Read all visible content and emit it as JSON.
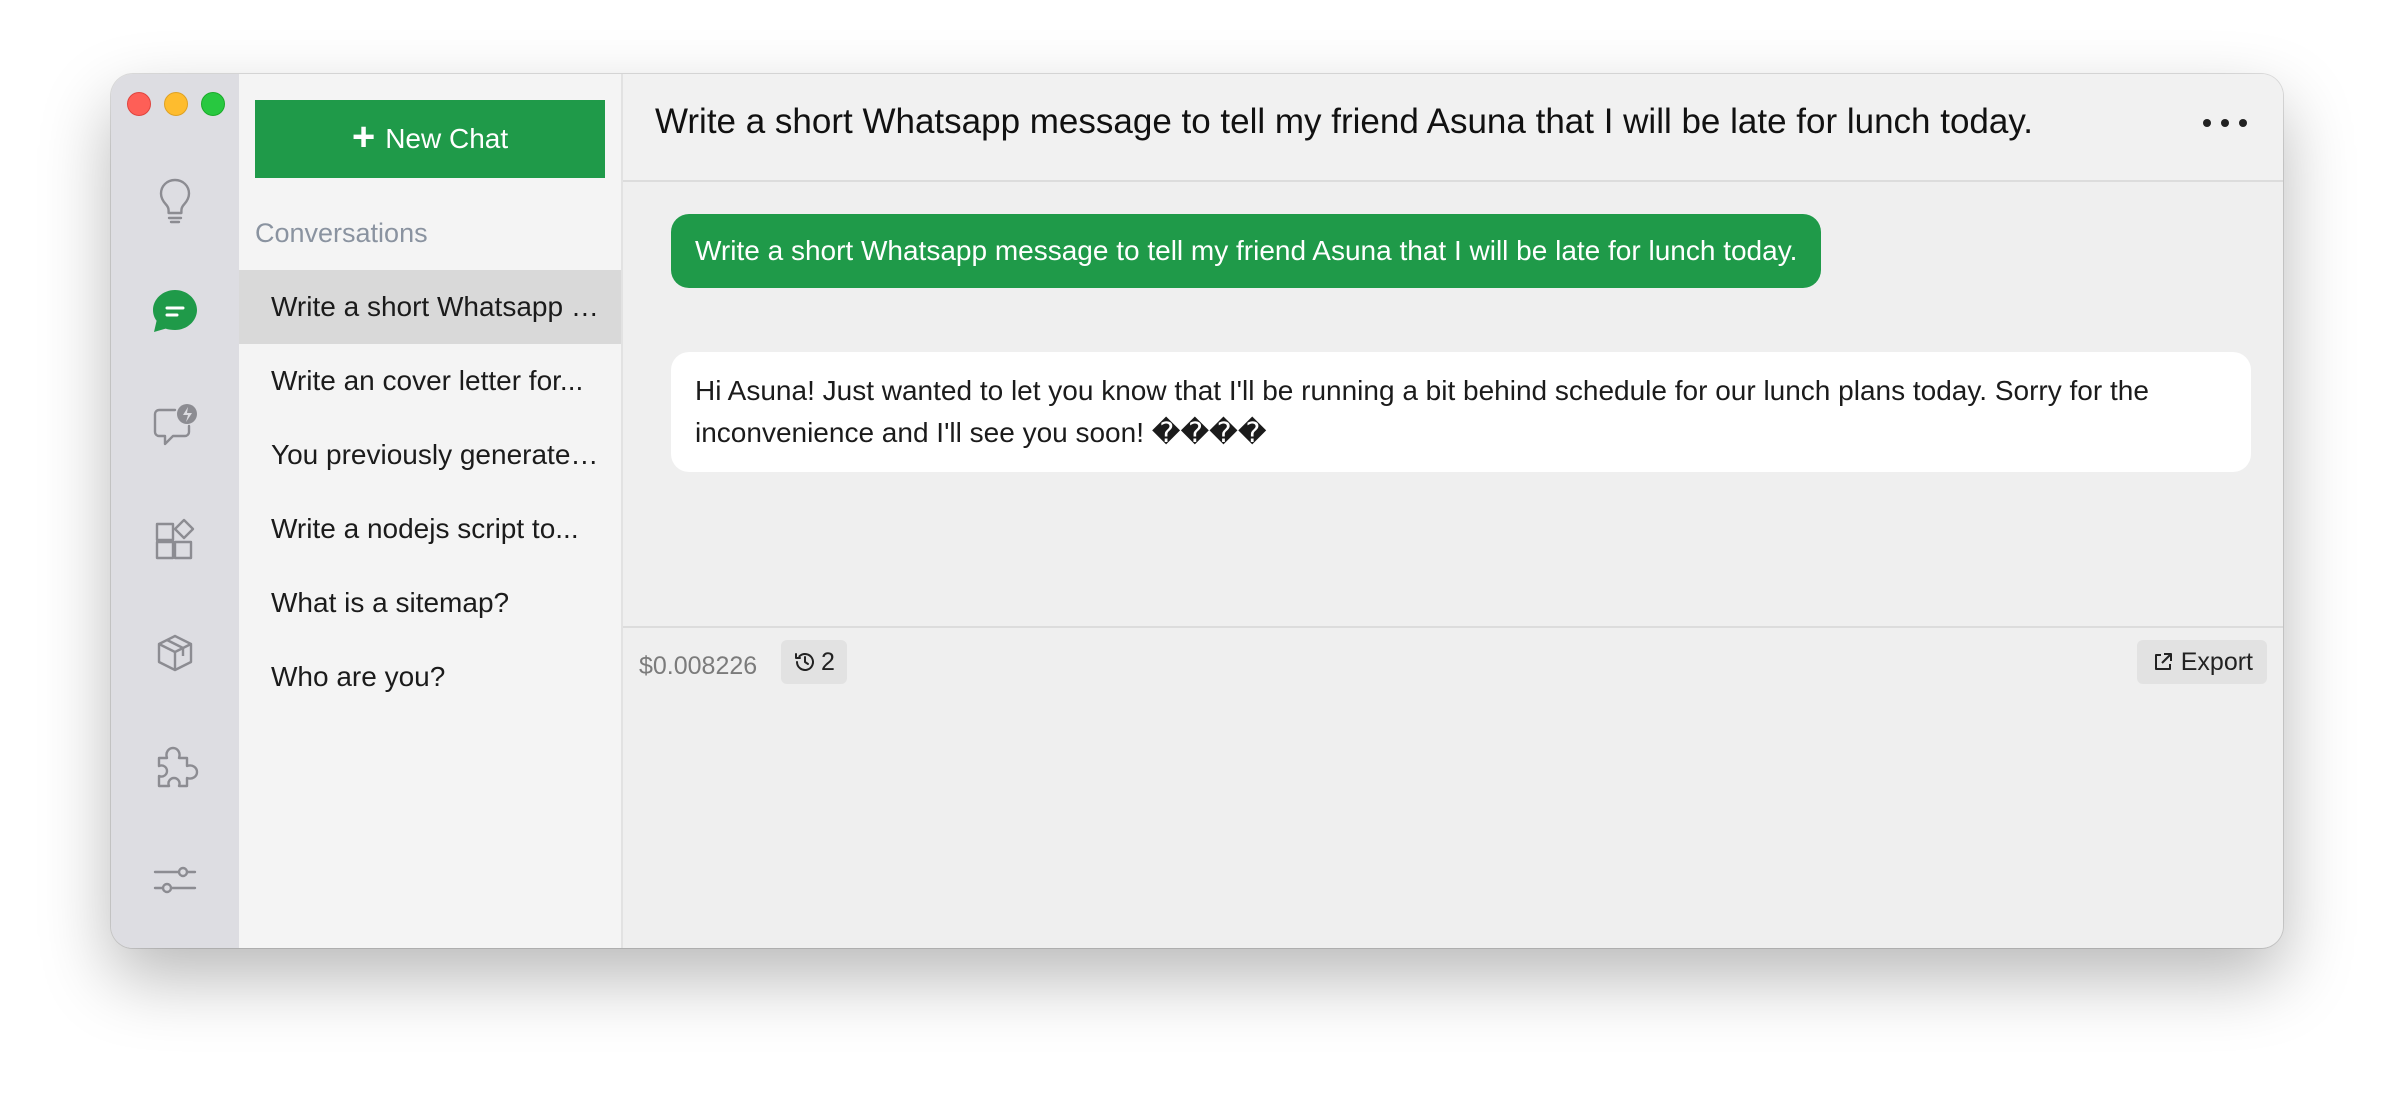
{
  "sidebar": {
    "new_chat_label": "New Chat",
    "heading": "Conversations",
    "conversations": [
      {
        "title": "Write a short Whatsapp message to tell my friend Asuna that I will be late for lunch today."
      },
      {
        "title": "Write an cover letter for..."
      },
      {
        "title": "You previously generated..."
      },
      {
        "title": "Write a nodejs script to..."
      },
      {
        "title": "What is a sitemap?"
      },
      {
        "title": "Who are you?"
      }
    ],
    "active_index": 0
  },
  "rail": {
    "icons": [
      "lightbulb-icon",
      "chat-bubble-icon",
      "chat-lightning-icon",
      "widgets-icon",
      "cube-icon",
      "puzzle-icon",
      "settings-sliders-icon"
    ],
    "active_icon": "chat-bubble-icon"
  },
  "header": {
    "title": "Write a short Whatsapp message to tell my friend Asuna that I will be late for lunch today.",
    "more_icon": "ellipsis-icon"
  },
  "messages": {
    "user": "Write a short Whatsapp message to tell my friend Asuna that I will be late for lunch today.",
    "assistant": "Hi Asuna! Just wanted to let you know that I'll be running a bit behind schedule for our lunch plans today. Sorry for the inconvenience and I'll see you soon! ����"
  },
  "footer": {
    "cost": "$0.008226",
    "history_count": "2",
    "history_icon": "history-icon",
    "export_label": "Export",
    "export_icon": "share-icon"
  },
  "colors": {
    "accent": "#1f9a49",
    "rail_bg": "#dddde2",
    "sidebar_bg": "#f4f4f4",
    "main_bg": "#efefef"
  }
}
